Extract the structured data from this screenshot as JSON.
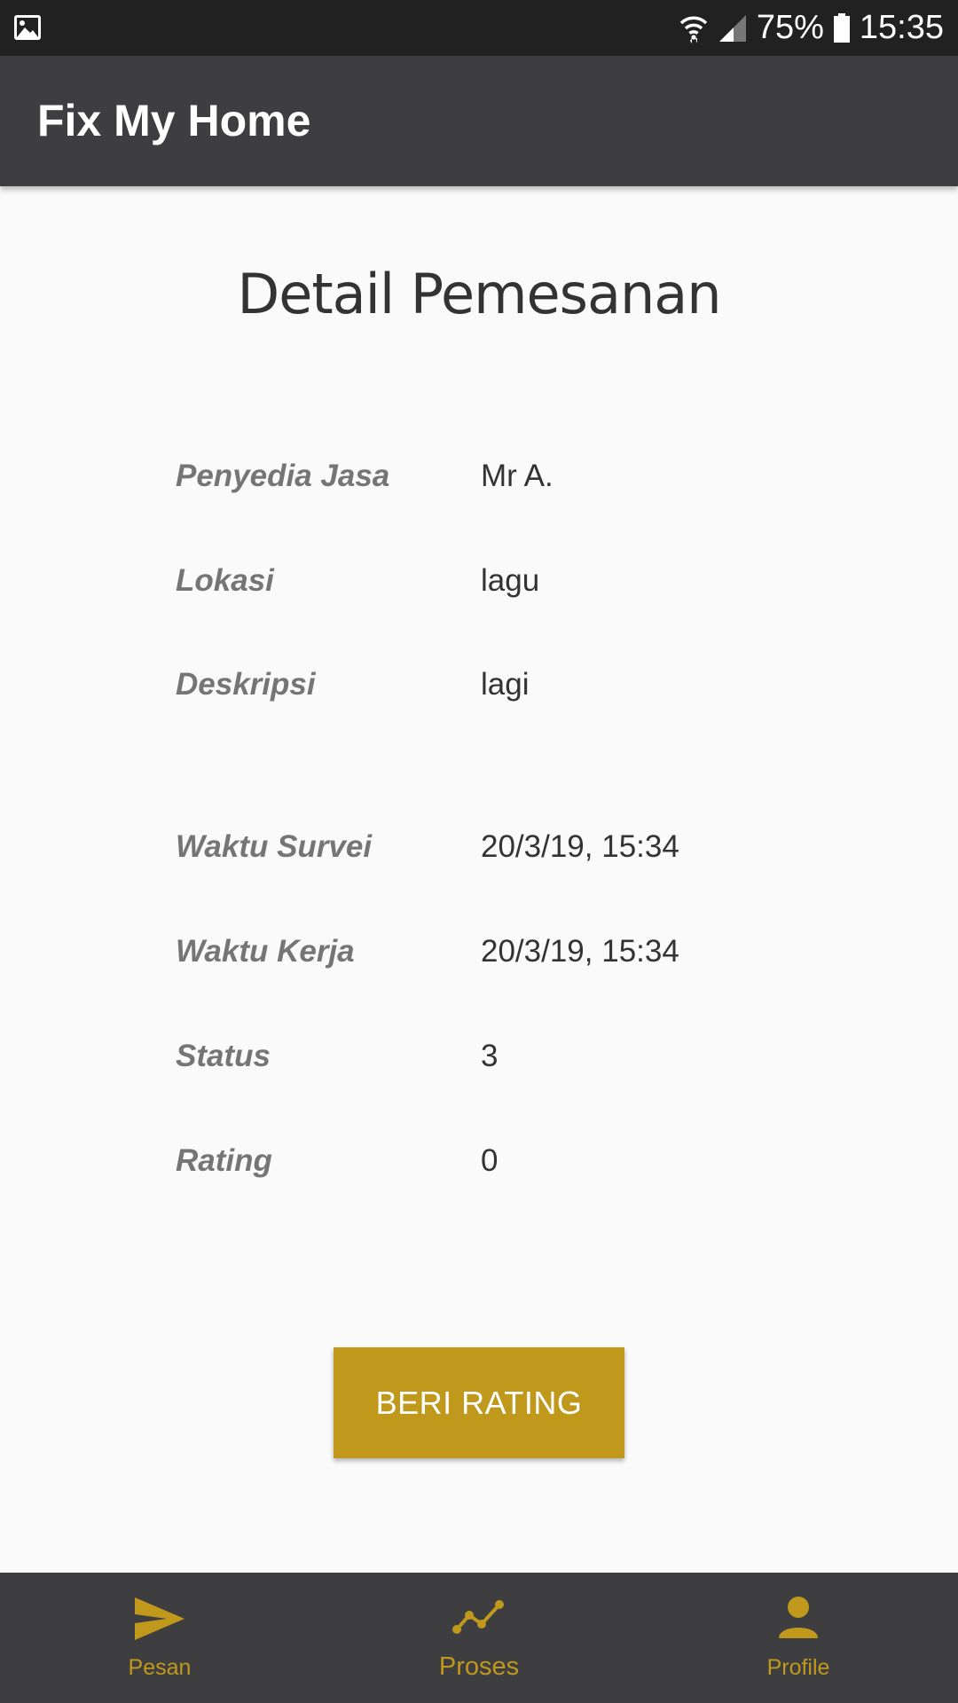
{
  "status_bar": {
    "battery": "75%",
    "time": "15:35"
  },
  "app_bar": {
    "title": "Fix My Home"
  },
  "page": {
    "title": "Detail Pemesanan"
  },
  "details": [
    {
      "label": "Penyedia Jasa",
      "value": "Mr A."
    },
    {
      "label": "Lokasi",
      "value": "lagu"
    },
    {
      "label": "Deskripsi",
      "value": "lagi"
    },
    {
      "label": "Waktu Survei",
      "value": "20/3/19, 15:34"
    },
    {
      "label": "Waktu Kerja",
      "value": "20/3/19, 15:34"
    },
    {
      "label": "Status",
      "value": "3"
    },
    {
      "label": "Rating",
      "value": "0"
    }
  ],
  "actions": {
    "rating_button": "BERI RATING"
  },
  "bottom_nav": {
    "items": [
      {
        "label": "Pesan",
        "icon": "send-icon"
      },
      {
        "label": "Proses",
        "icon": "trending-icon"
      },
      {
        "label": "Profile",
        "icon": "person-icon"
      }
    ],
    "active_index": 1
  },
  "colors": {
    "accent": "#c0981b",
    "app_bar": "#3e3e41",
    "status_bar": "#212121",
    "background": "#fafafa"
  }
}
